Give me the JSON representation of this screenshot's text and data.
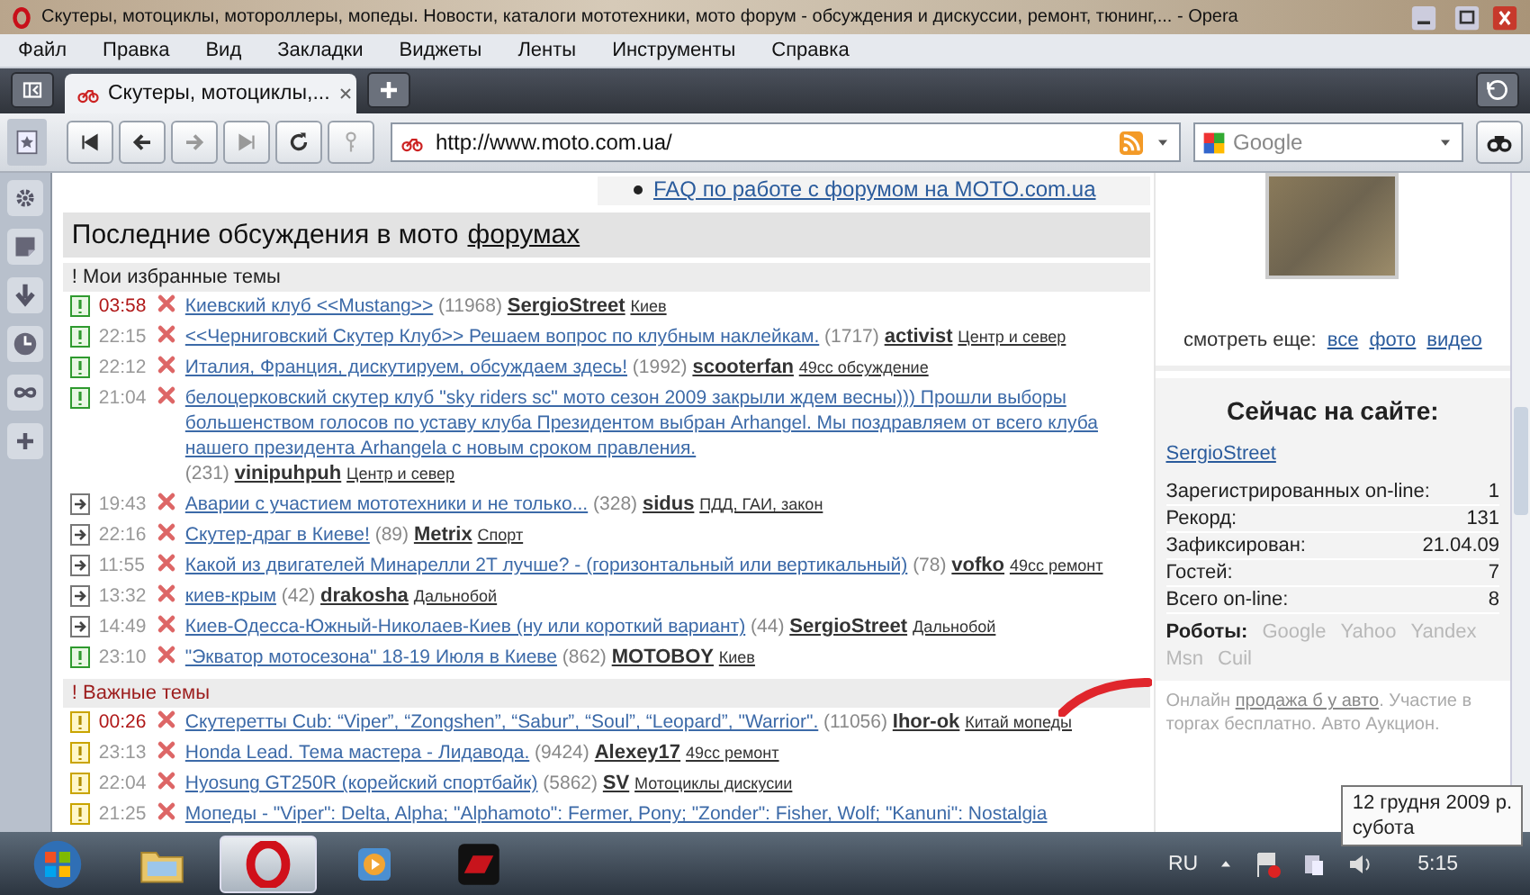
{
  "window": {
    "title": "Скутеры, мотоциклы, мотороллеры, мопеды. Новости, каталоги мототехники, мото форум - обсуждения и дискуссии, ремонт, тюнинг,... - Opera"
  },
  "menu": [
    "Файл",
    "Правка",
    "Вид",
    "Закладки",
    "Виджеты",
    "Ленты",
    "Инструменты",
    "Справка"
  ],
  "tabs": [
    {
      "label": "Скутеры, мотоциклы,...",
      "selected": true
    }
  ],
  "address": {
    "url": "http://www.moto.com.ua/"
  },
  "search": {
    "placeholder": "Google"
  },
  "faq_link": "FAQ по работе с форумом на MOTO.com.ua",
  "heading": {
    "text": "Последние обсуждения в мото",
    "link": "форумах"
  },
  "groups": [
    {
      "title": "! Мои избранные темы",
      "kind": "favorite",
      "topics": [
        {
          "kind": "favorite",
          "time": "03:58",
          "fresh": true,
          "title": "Киевский клуб <<Mustang>>",
          "count": "(11968)",
          "author": "SergioStreet",
          "category": "Киев"
        },
        {
          "kind": "favorite",
          "time": "22:15",
          "fresh": false,
          "title": "<<Черниговский Скутер Клуб>> Решаем вопрос по клубным наклейкам.",
          "count": "(1717)",
          "author": "activist",
          "category": "Центр и север"
        },
        {
          "kind": "favorite",
          "time": "22:12",
          "fresh": false,
          "title": "Италия, Франция, дискутируем, обсуждаем здесь!",
          "count": "(1992)",
          "author": "scooterfan",
          "category": "49сс обсуждение"
        },
        {
          "kind": "favorite",
          "time": "21:04",
          "fresh": false,
          "title": "белоцерковский скутер клуб \"sky riders sc\" мото сезон 2009 закрыли ждем весны))) Прошли выборы большенством голосов по уставу клуба Президентом выбран Arhangel. Мы поздравляем от всего клуба нашего президента Arhangela с новым сроком правления.",
          "count": "(231)",
          "author": "vinipuhpuh",
          "category": "Центр и север"
        },
        {
          "kind": "moved",
          "time": "19:43",
          "fresh": false,
          "title": "Аварии с участием мототехники и не только...",
          "count": "(328)",
          "author": "sidus",
          "category": "ПДД, ГАИ, закон"
        },
        {
          "kind": "moved",
          "time": "22:16",
          "fresh": false,
          "title": "Скутер-драг в Киеве!",
          "count": "(89)",
          "author": "Metrix",
          "category": "Спорт"
        },
        {
          "kind": "moved",
          "time": "11:55",
          "fresh": false,
          "title": "Какой из двигателей Минарелли 2Т лучше? - (горизонтальный или вертикальный)",
          "count": "(78)",
          "author": "vofko",
          "category": "49сс ремонт"
        },
        {
          "kind": "moved",
          "time": "13:32",
          "fresh": false,
          "title": "киев-крым",
          "count": "(42)",
          "author": "drakosha",
          "category": "Дальнобой"
        },
        {
          "kind": "moved",
          "time": "14:49",
          "fresh": false,
          "title": "Киев-Одесса-Южный-Николаев-Киев (ну или короткий вариант)",
          "count": "(44)",
          "author": "SergioStreet",
          "category": "Дальнобой"
        },
        {
          "kind": "favorite",
          "time": "23:10",
          "fresh": false,
          "title": "\"Экватор мотосезона\" 18-19 Июля в Киеве",
          "count": "(862)",
          "author": "MOTOBOY",
          "category": "Киев"
        }
      ]
    },
    {
      "title": "! Важные темы",
      "kind": "important",
      "topics": [
        {
          "kind": "important",
          "time": "00:26",
          "fresh": true,
          "title": "Скутеретты Cub: “Viper”, “Zongshen”, “Sabur”, “Soul”, “Leopard”, \"Warrior\".",
          "count": "(11056)",
          "author": "Ihor-ok",
          "category": "Китай мопеды"
        },
        {
          "kind": "important",
          "time": "23:13",
          "fresh": false,
          "title": "Honda Lead. Тема мастера - Лидавода.",
          "count": "(9424)",
          "author": "Alexey17",
          "category": "49сс ремонт"
        },
        {
          "kind": "important",
          "time": "22:04",
          "fresh": false,
          "title": "Hyosung GT250R (корейский спортбайк)",
          "count": "(5862)",
          "author": "SV",
          "category": "Мотоциклы дискусии"
        },
        {
          "kind": "important",
          "time": "21:25",
          "fresh": false,
          "title": "Мопеды - \"Viper\": Delta, Alpha; \"Alphamoto\": Fermer, Pony; \"Zonder\": Fisher, Wolf; \"Kanuni\": Nostalgia"
        }
      ]
    }
  ],
  "gallery": {
    "more_label": "смотреть еще:",
    "links": [
      "все",
      "фото",
      "видео"
    ]
  },
  "online": {
    "title": "Сейчас на сайте:",
    "users": [
      "SergioStreet"
    ],
    "stats": [
      {
        "label": "Зарегистрированных on-line:",
        "value": "1"
      },
      {
        "label": "Рекорд:",
        "value": "131"
      },
      {
        "label": "Зафиксирован:",
        "value": "21.04.09"
      },
      {
        "label": "Гостей:",
        "value": "7"
      },
      {
        "label": "Всего on-line:",
        "value": "8"
      }
    ],
    "robots_label": "Роботы:",
    "robots": [
      "Google",
      "Yahoo",
      "Yandex",
      "Msn",
      "Cuil"
    ]
  },
  "ad": {
    "before": "Онлайн",
    "link": "продажа б у авто",
    "after": ". Участие в торгах бесплатно. Авто Аукцион."
  },
  "taskbar": {
    "apps": [
      {
        "kind": "folder",
        "selected": false
      },
      {
        "kind": "opera",
        "selected": true
      },
      {
        "kind": "media",
        "selected": false
      },
      {
        "kind": "game",
        "selected": false
      }
    ],
    "language": "RU",
    "clock": "5:15",
    "tooltip": [
      "12 грудня 2009 р.",
      "субота"
    ]
  }
}
